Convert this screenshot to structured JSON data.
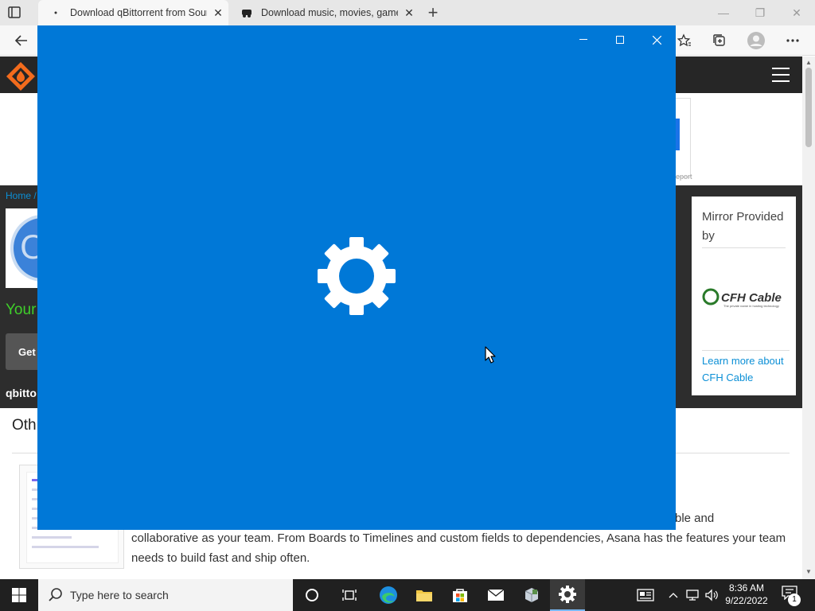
{
  "browser": {
    "tabs": [
      {
        "title": "Download qBittorrent from Sour",
        "favicon": "loading-dot-icon",
        "active": true
      },
      {
        "title": "Download music, movies, games",
        "favicon": "torrent-site-icon",
        "active": false
      }
    ],
    "new_tab": "+"
  },
  "page": {
    "breadcrumb": "Home /",
    "project_icon_letter": "C",
    "tagline": "Your",
    "get_button": "Get",
    "project_name": "qbitto",
    "ad_report": "eport",
    "mirror": {
      "title": "Mirror Provided by",
      "logo_text": "CFH Cable",
      "link": "Learn more about CFH Cable"
    },
    "other_title": "Oth",
    "desc_tail": "ble and",
    "description": "collaborative as your team. From Boards to Timelines and custom fields to dependencies, Asana has the features your team needs to build fast and ship often."
  },
  "splash": {
    "app": "Settings",
    "icon": "gear-icon",
    "background": "#0078d7"
  },
  "taskbar": {
    "search_placeholder": "Type here to search",
    "time": "8:36 AM",
    "date": "9/22/2022",
    "notification_count": "1",
    "apps": [
      "cortana-icon",
      "task-view-icon",
      "edge-icon",
      "file-explorer-icon",
      "store-icon",
      "mail-icon",
      "app-icon",
      "settings-icon"
    ]
  }
}
